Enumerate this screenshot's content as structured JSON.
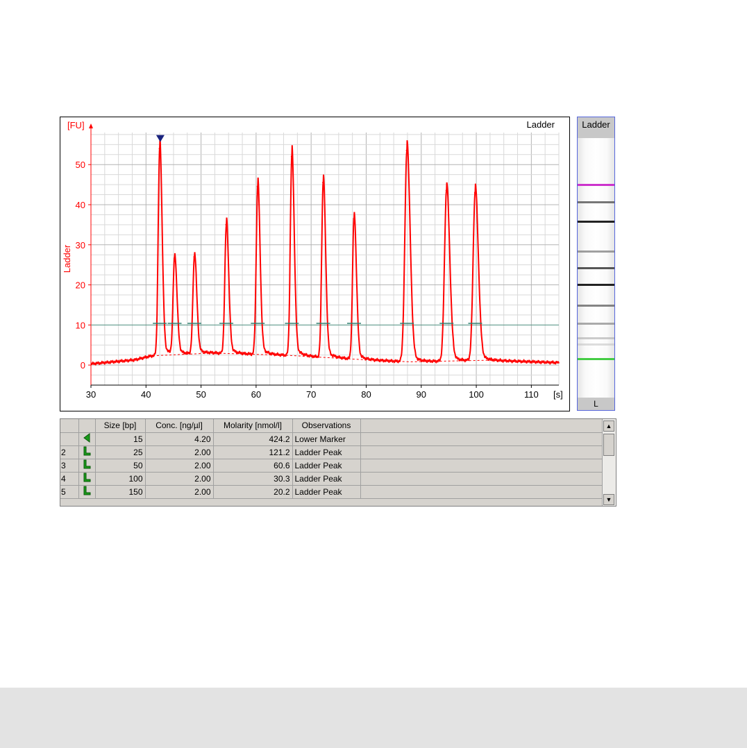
{
  "chart_data": {
    "type": "line",
    "title": "Ladder",
    "xlabel": "[s]",
    "ylabel": "Ladder",
    "yunit": "[FU]",
    "xlim": [
      30,
      115
    ],
    "ylim": [
      -5,
      58
    ],
    "xticks": [
      30,
      40,
      50,
      60,
      70,
      80,
      90,
      100,
      110
    ],
    "yticks": [
      0,
      10,
      20,
      30,
      40,
      50
    ],
    "grid": true,
    "threshold": 10,
    "marker_peak_x": 42.6,
    "series": [
      {
        "color": "#ff0000",
        "peaks": [
          {
            "x": 42.5,
            "y": 54
          },
          {
            "x": 45.2,
            "y": 26.5
          },
          {
            "x": 48.8,
            "y": 27
          },
          {
            "x": 54.6,
            "y": 35
          },
          {
            "x": 60.3,
            "y": 44.5
          },
          {
            "x": 66.5,
            "y": 52
          },
          {
            "x": 72.2,
            "y": 45.5
          },
          {
            "x": 77.8,
            "y": 36.5
          },
          {
            "x": 87.4,
            "y": 53.5
          },
          {
            "x": 94.6,
            "y": 43.5
          },
          {
            "x": 99.8,
            "y": 43
          }
        ],
        "baseline_points": [
          {
            "x": 30,
            "y": 0.3
          },
          {
            "x": 38,
            "y": 1.3
          },
          {
            "x": 41,
            "y": 2.3
          },
          {
            "x": 52,
            "y": 3
          },
          {
            "x": 66,
            "y": 2.4
          },
          {
            "x": 80,
            "y": 1.3
          },
          {
            "x": 88,
            "y": 0.8
          },
          {
            "x": 102,
            "y": 1.2
          },
          {
            "x": 115,
            "y": 0.6
          }
        ]
      }
    ]
  },
  "gel": {
    "header": "Ladder",
    "footer": "L",
    "marker_colors": {
      "upper": "#cc33cc",
      "lower": "#44cc44"
    },
    "bands": [
      {
        "pos": 0.18,
        "color": "#cc33cc",
        "strength": 1
      },
      {
        "pos": 0.245,
        "color": "#555555",
        "strength": 0.8
      },
      {
        "pos": 0.32,
        "color": "#222222",
        "strength": 1
      },
      {
        "pos": 0.435,
        "color": "#777777",
        "strength": 0.7
      },
      {
        "pos": 0.5,
        "color": "#444444",
        "strength": 0.9
      },
      {
        "pos": 0.565,
        "color": "#222222",
        "strength": 1
      },
      {
        "pos": 0.645,
        "color": "#666666",
        "strength": 0.8
      },
      {
        "pos": 0.715,
        "color": "#888888",
        "strength": 0.7
      },
      {
        "pos": 0.77,
        "color": "#aaaaaa",
        "strength": 0.6
      },
      {
        "pos": 0.795,
        "color": "#bbbbbb",
        "strength": 0.5
      },
      {
        "pos": 0.85,
        "color": "#44cc44",
        "strength": 1
      }
    ]
  },
  "table": {
    "headers": [
      "Size [bp]",
      "Conc. [ng/µl]",
      "Molarity [nmol/l]",
      "Observations"
    ],
    "rows": [
      {
        "index": "",
        "icon": "lower-marker-icon",
        "size": "15",
        "conc": "4.20",
        "molarity": "424.2",
        "obs": "Lower Marker",
        "selected": true
      },
      {
        "index": "2",
        "icon": "ladder-peak-icon",
        "size": "25",
        "conc": "2.00",
        "molarity": "121.2",
        "obs": "Ladder Peak"
      },
      {
        "index": "3",
        "icon": "ladder-peak-icon",
        "size": "50",
        "conc": "2.00",
        "molarity": "60.6",
        "obs": "Ladder Peak"
      },
      {
        "index": "4",
        "icon": "ladder-peak-icon",
        "size": "100",
        "conc": "2.00",
        "molarity": "30.3",
        "obs": "Ladder Peak"
      },
      {
        "index": "5",
        "icon": "ladder-peak-icon",
        "size": "150",
        "conc": "2.00",
        "molarity": "20.2",
        "obs": "Ladder Peak"
      }
    ]
  }
}
